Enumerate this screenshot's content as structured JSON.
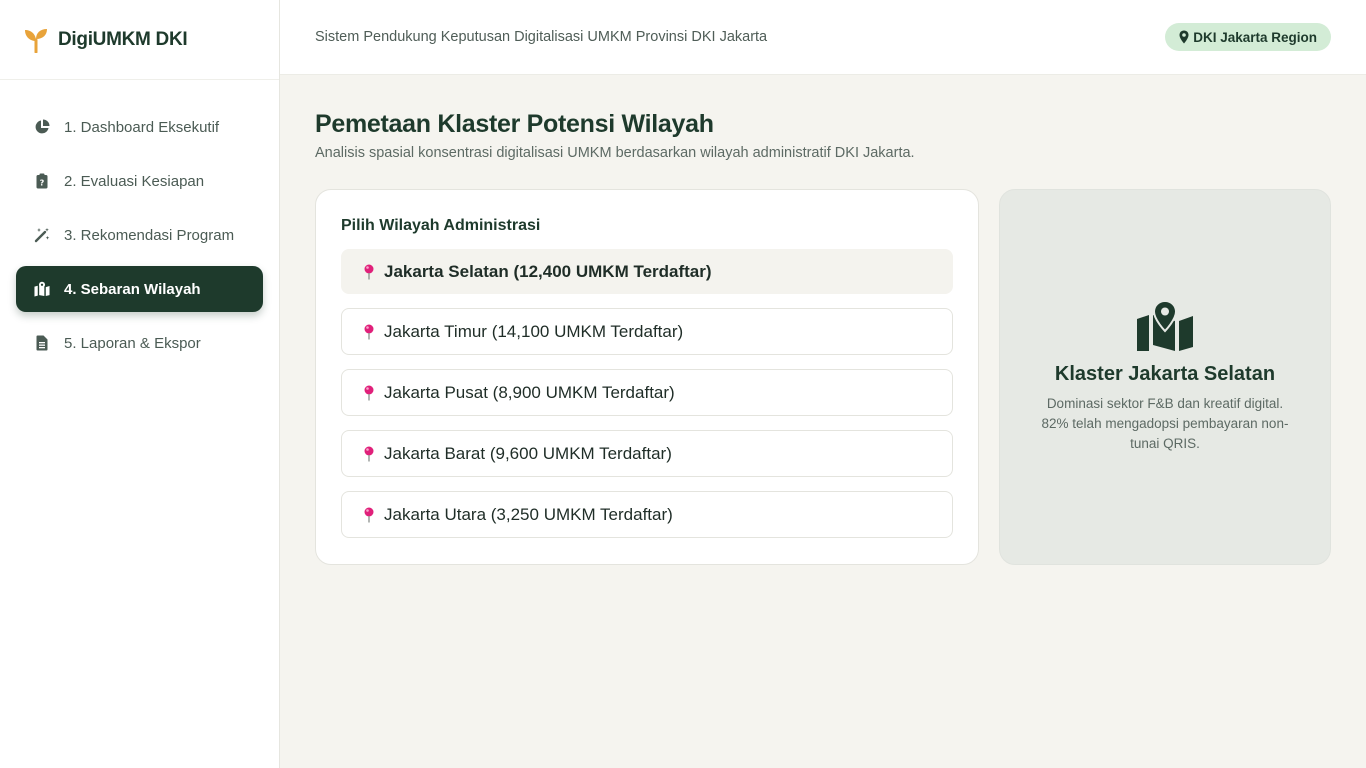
{
  "brand": {
    "name": "DigiUMKM DKI",
    "icon": "sprout-icon"
  },
  "sidebar": {
    "items": [
      {
        "label": "1. Dashboard Eksekutif",
        "icon": "pie-chart-icon",
        "active": false
      },
      {
        "label": "2. Evaluasi Kesiapan",
        "icon": "clipboard-icon",
        "active": false
      },
      {
        "label": "3. Rekomendasi Program",
        "icon": "magic-wand-icon",
        "active": false
      },
      {
        "label": "4. Sebaran Wilayah",
        "icon": "map-marked-icon",
        "active": true
      },
      {
        "label": "5. Laporan & Ekspor",
        "icon": "file-icon",
        "active": false
      }
    ]
  },
  "header": {
    "title": "Sistem Pendukung Keputusan Digitalisasi UMKM Provinsi DKI Jakarta",
    "region_badge": "DKI Jakarta Region"
  },
  "main": {
    "title": "Pemetaan Klaster Potensi Wilayah",
    "subtitle": "Analisis spasial konsentrasi digitalisasi UMKM berdasarkan wilayah administratif DKI Jakarta.",
    "selector": {
      "title": "Pilih Wilayah Administrasi",
      "regions": [
        {
          "label": "Jakarta Selatan (12,400 UMKM Terdaftar)",
          "selected": true
        },
        {
          "label": "Jakarta Timur (14,100 UMKM Terdaftar)",
          "selected": false
        },
        {
          "label": "Jakarta Pusat (8,900 UMKM Terdaftar)",
          "selected": false
        },
        {
          "label": "Jakarta Barat (9,600 UMKM Terdaftar)",
          "selected": false
        },
        {
          "label": "Jakarta Utara (3,250 UMKM Terdaftar)",
          "selected": false
        }
      ]
    },
    "cluster": {
      "icon": "map-location-icon",
      "title": "Klaster Jakarta Selatan",
      "description": "Dominasi sektor F&B dan kreatif digital. 82% telah mengadopsi pembayaran non-tunai QRIS."
    }
  },
  "colors": {
    "primary": "#1e3a2c",
    "background": "#f5f4ef",
    "badge_bg": "#d3ecd6",
    "brand_accent": "#e8a33a",
    "pin": "#e0207a"
  }
}
